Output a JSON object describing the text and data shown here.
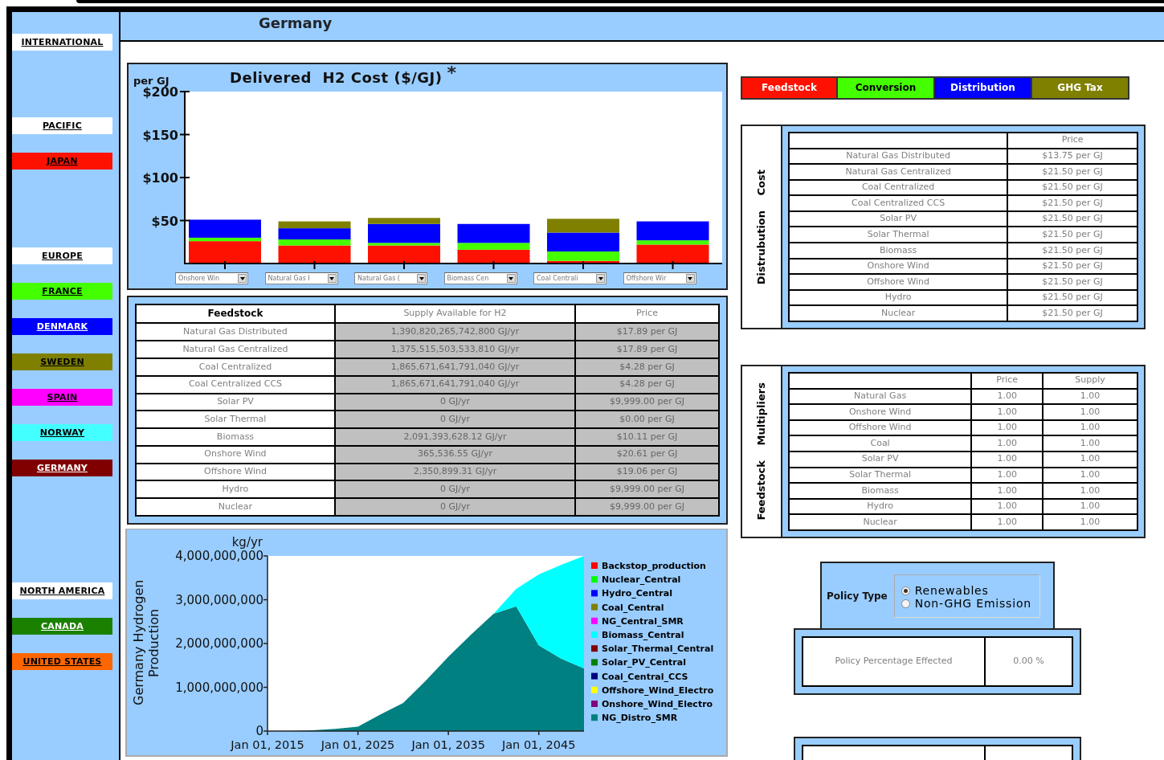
{
  "sidebar": {
    "groups": [
      {
        "label": "INTERNATIONAL"
      },
      {
        "label": "PACIFIC",
        "items": [
          {
            "label": "JAPAN",
            "color": "#ff1100"
          }
        ]
      },
      {
        "label": "EUROPE",
        "items": [
          {
            "label": "FRANCE",
            "color": "#44ff00"
          },
          {
            "label": "DENMARK",
            "color": "#0000ff"
          },
          {
            "label": "SWEDEN",
            "color": "#808000"
          },
          {
            "label": "SPAIN",
            "color": "#ff00ff"
          },
          {
            "label": "NORWAY",
            "color": "#44ffff"
          },
          {
            "label": "GERMANY",
            "color": "#800000"
          }
        ]
      },
      {
        "label": "NORTH AMERICA",
        "items": [
          {
            "label": "CANADA",
            "color": "#1a8000"
          },
          {
            "label": "UNITED STATES",
            "color": "#ff6600"
          }
        ]
      }
    ]
  },
  "header": {
    "title": "Germany"
  },
  "cost_chart": {
    "note_mark": "*",
    "chart_data": {
      "type": "bar",
      "title": "Delivered  H2 Cost ($/GJ)",
      "ylabel": "per GJ",
      "stacked": true,
      "categories": [
        "Onshore Win",
        "Natural Gas I",
        "Natural Gas (",
        "Biomass Cen",
        "Coal Centrali",
        "Offshore Wir"
      ],
      "ylim": [
        0,
        200
      ],
      "yticks": [
        {
          "value": 50,
          "label": "$50"
        },
        {
          "value": 100,
          "label": "$100"
        },
        {
          "value": 150,
          "label": "$150"
        },
        {
          "value": 200,
          "label": "$200"
        }
      ],
      "series": [
        {
          "name": "Feedstock",
          "color": "#ff1100",
          "values": [
            26,
            21,
            21,
            16,
            3,
            22
          ]
        },
        {
          "name": "Conversion",
          "color": "#44ff00",
          "values": [
            4,
            7,
            3,
            8,
            11,
            5
          ]
        },
        {
          "name": "Distribution",
          "color": "#0000ff",
          "values": [
            21,
            13,
            22,
            22,
            22,
            22
          ]
        },
        {
          "name": "GHG Tax",
          "color": "#808000",
          "values": [
            0,
            8,
            7,
            0,
            16,
            0
          ]
        }
      ]
    }
  },
  "feedstock_table": {
    "columns": [
      "Feedstock",
      "Supply Available for H2",
      "Price"
    ],
    "rows": [
      [
        "Natural Gas Distributed",
        "1,390,820,265,742,800 GJ/yr",
        "$17.89 per GJ"
      ],
      [
        "Natural Gas Centralized",
        "1,375,515,503,533,810 GJ/yr",
        "$17.89 per GJ"
      ],
      [
        "Coal Centralized",
        "1,865,671,641,791,040 GJ/yr",
        "$4.28 per GJ"
      ],
      [
        "Coal Centralized CCS",
        "1,865,671,641,791,040 GJ/yr",
        "$4.28 per GJ"
      ],
      [
        "Solar PV",
        "0 GJ/yr",
        "$9,999.00 per GJ"
      ],
      [
        "Solar Thermal",
        "0 GJ/yr",
        "$0.00 per GJ"
      ],
      [
        "Biomass",
        "2,091,393,628.12 GJ/yr",
        "$10.11 per GJ"
      ],
      [
        "Onshore Wind",
        "365,536.55 GJ/yr",
        "$20.61 per GJ"
      ],
      [
        "Offshore Wind",
        "2,350,899.31 GJ/yr",
        "$19.06 per GJ"
      ],
      [
        "Hydro",
        "0 GJ/yr",
        "$9,999.00 per GJ"
      ],
      [
        "Nuclear",
        "0 GJ/yr",
        "$9,999.00 per GJ"
      ]
    ]
  },
  "production_chart": {
    "unit": "kg/yr",
    "chart_data": {
      "type": "area",
      "stacked": true,
      "legend": "right",
      "ylabel": "Germany Hydrogen Production",
      "categories": [
        "Jan 01, 2015",
        null,
        null,
        null,
        "Jan 01, 2025",
        null,
        null,
        null,
        "Jan 01, 2035",
        null,
        null,
        null,
        "Jan 01, 2045",
        null,
        null
      ],
      "ylim": [
        0,
        4000000000
      ],
      "yticks": [
        {
          "value": 0,
          "label": "0"
        },
        {
          "value": 1000000000,
          "label": "1,000,000,000"
        },
        {
          "value": 2000000000,
          "label": "2,000,000,000"
        },
        {
          "value": 3000000000,
          "label": "3,000,000,000"
        },
        {
          "value": 4000000000,
          "label": "4,000,000,000"
        }
      ],
      "series": [
        {
          "name": "Backstop_production",
          "color": "#ff0000",
          "values": [
            null,
            null,
            null,
            null,
            null,
            null,
            null,
            null,
            null,
            null,
            null,
            null,
            null,
            null,
            null
          ]
        },
        {
          "name": "Nuclear_Central",
          "color": "#00ff00",
          "values": [
            null,
            null,
            null,
            null,
            null,
            null,
            null,
            null,
            null,
            null,
            null,
            null,
            null,
            null,
            null
          ]
        },
        {
          "name": "Hydro_Central",
          "color": "#0000ff",
          "values": [
            null,
            null,
            null,
            null,
            null,
            null,
            null,
            null,
            null,
            null,
            null,
            null,
            null,
            null,
            null
          ]
        },
        {
          "name": "Coal_Central",
          "color": "#808000",
          "values": [
            null,
            null,
            null,
            null,
            null,
            null,
            null,
            null,
            null,
            null,
            null,
            null,
            null,
            null,
            null
          ]
        },
        {
          "name": "NG_Central_SMR",
          "color": "#ff00ff",
          "values": [
            null,
            null,
            null,
            null,
            null,
            null,
            null,
            null,
            null,
            null,
            null,
            null,
            null,
            null,
            null
          ]
        },
        {
          "name": "Biomass_Central",
          "color": "#00ffff",
          "values": [
            0,
            0,
            0,
            0,
            0,
            0,
            0,
            0,
            0,
            0,
            0,
            400000000,
            1620000000,
            2150000000,
            2570000000
          ]
        },
        {
          "name": "Solar_Thermal_Central",
          "color": "#800000",
          "values": [
            null,
            null,
            null,
            null,
            null,
            null,
            null,
            null,
            null,
            null,
            null,
            null,
            null,
            null,
            null
          ]
        },
        {
          "name": "Solar_PV_Central",
          "color": "#008000",
          "values": [
            null,
            null,
            null,
            null,
            null,
            null,
            null,
            null,
            null,
            null,
            null,
            null,
            null,
            null,
            null
          ]
        },
        {
          "name": "Coal_Central_CCS",
          "color": "#000080",
          "values": [
            null,
            null,
            null,
            null,
            null,
            null,
            null,
            null,
            null,
            null,
            null,
            null,
            null,
            null,
            null
          ]
        },
        {
          "name": "Offshore_Wind_Electro",
          "color": "#ffff00",
          "values": [
            null,
            null,
            null,
            null,
            null,
            null,
            null,
            null,
            null,
            null,
            null,
            null,
            null,
            null,
            null
          ]
        },
        {
          "name": "Onshore_Wind_Electro",
          "color": "#800080",
          "values": [
            null,
            null,
            null,
            null,
            null,
            null,
            null,
            null,
            null,
            null,
            null,
            null,
            null,
            null,
            null
          ]
        },
        {
          "name": "NG_Distro_SMR",
          "color": "#008080",
          "values": [
            0,
            0,
            20000000,
            50000000,
            100000000,
            380000000,
            640000000,
            1150000000,
            1700000000,
            2200000000,
            2680000000,
            2850000000,
            1960000000,
            1650000000,
            1430000000
          ]
        }
      ]
    }
  },
  "distribution_cost": {
    "title": "Distrubution Cost",
    "columns": [
      "",
      "Price"
    ],
    "rows": [
      [
        "Natural Gas Distributed",
        "$13.75 per GJ"
      ],
      [
        "Natural Gas Centralized",
        "$21.50 per GJ"
      ],
      [
        "Coal Centralized",
        "$21.50 per GJ"
      ],
      [
        "Coal Centralized CCS",
        "$21.50 per GJ"
      ],
      [
        "Solar PV",
        "$21.50 per GJ"
      ],
      [
        "Solar Thermal",
        "$21.50 per GJ"
      ],
      [
        "Biomass",
        "$21.50 per GJ"
      ],
      [
        "Onshore Wind",
        "$21.50 per GJ"
      ],
      [
        "Offshore Wind",
        "$21.50 per GJ"
      ],
      [
        "Hydro",
        "$21.50 per GJ"
      ],
      [
        "Nuclear",
        "$21.50 per GJ"
      ]
    ]
  },
  "feedstock_multipliers": {
    "title": "Feedstock Multipliers",
    "columns": [
      "",
      "Price",
      "Supply"
    ],
    "rows": [
      [
        "Natural Gas",
        "1.00",
        "1.00"
      ],
      [
        "Onshore Wind",
        "1.00",
        "1.00"
      ],
      [
        "Offshore Wind",
        "1.00",
        "1.00"
      ],
      [
        "Coal",
        "1.00",
        "1.00"
      ],
      [
        "Solar PV",
        "1.00",
        "1.00"
      ],
      [
        "Solar Thermal",
        "1.00",
        "1.00"
      ],
      [
        "Biomass",
        "1.00",
        "1.00"
      ],
      [
        "Hydro",
        "1.00",
        "1.00"
      ],
      [
        "Nuclear",
        "1.00",
        "1.00"
      ]
    ]
  },
  "policy": {
    "label": "Policy Type",
    "options": [
      {
        "label": "Renewables",
        "selected": true
      },
      {
        "label": "Non-GHG Emission",
        "selected": false
      }
    ],
    "percentage": {
      "label": "Policy Percentage Effected",
      "value": "0.00 %"
    }
  }
}
